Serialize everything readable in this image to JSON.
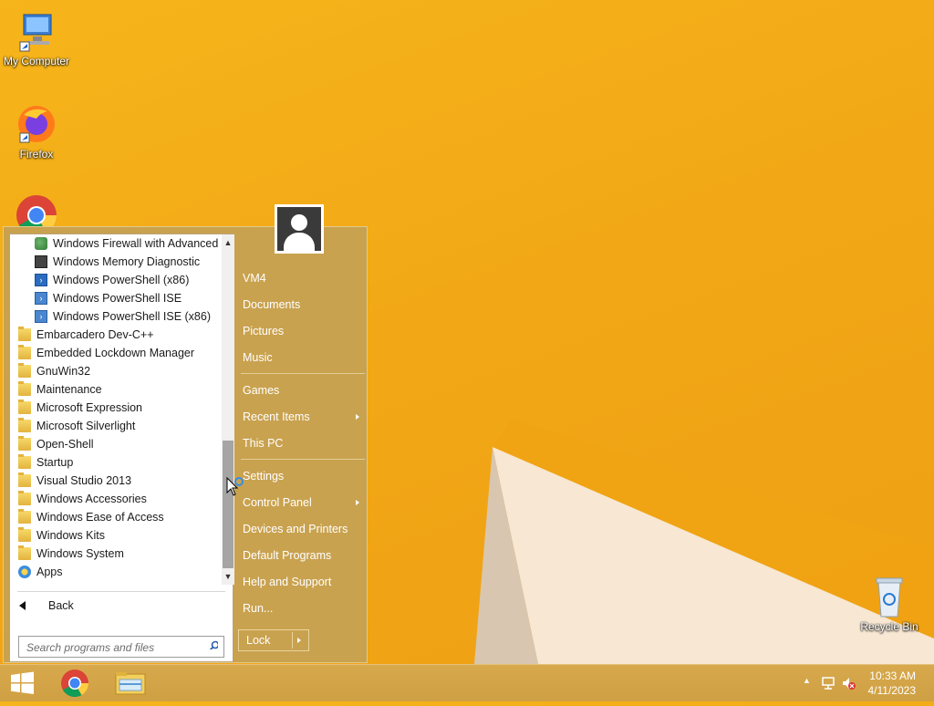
{
  "desktop": {
    "icons": [
      {
        "label": "My Computer",
        "icon": "computer-icon"
      },
      {
        "label": "Firefox",
        "icon": "firefox-icon"
      },
      {
        "label": "",
        "icon": "chrome-icon"
      },
      {
        "label": "Recycle Bin",
        "icon": "recycle-bin-icon"
      }
    ]
  },
  "start_menu": {
    "programs": [
      {
        "label": "Windows Firewall with Advanced",
        "icon": "firewall-icon",
        "level": "sub"
      },
      {
        "label": "Windows Memory Diagnostic",
        "icon": "memory-diagnostic-icon",
        "level": "sub"
      },
      {
        "label": "Windows PowerShell (x86)",
        "icon": "powershell-icon",
        "level": "sub"
      },
      {
        "label": "Windows PowerShell ISE",
        "icon": "powershell-ise-icon",
        "level": "sub"
      },
      {
        "label": "Windows PowerShell ISE (x86)",
        "icon": "powershell-ise-icon",
        "level": "sub"
      },
      {
        "label": "Embarcadero Dev-C++",
        "icon": "folder-icon",
        "level": "top"
      },
      {
        "label": "Embedded Lockdown Manager",
        "icon": "folder-icon",
        "level": "top"
      },
      {
        "label": "GnuWin32",
        "icon": "folder-icon",
        "level": "top"
      },
      {
        "label": "Maintenance",
        "icon": "folder-icon",
        "level": "top"
      },
      {
        "label": "Microsoft Expression",
        "icon": "folder-icon",
        "level": "top"
      },
      {
        "label": "Microsoft Silverlight",
        "icon": "folder-icon",
        "level": "top"
      },
      {
        "label": "Open-Shell",
        "icon": "folder-icon",
        "level": "top"
      },
      {
        "label": "Startup",
        "icon": "folder-icon",
        "level": "top"
      },
      {
        "label": "Visual Studio 2013",
        "icon": "folder-icon",
        "level": "top"
      },
      {
        "label": "Windows Accessories",
        "icon": "folder-icon",
        "level": "top"
      },
      {
        "label": "Windows Ease of Access",
        "icon": "folder-icon",
        "level": "top"
      },
      {
        "label": "Windows Kits",
        "icon": "folder-icon",
        "level": "top"
      },
      {
        "label": "Windows System",
        "icon": "folder-icon",
        "level": "top"
      },
      {
        "label": "Apps",
        "icon": "apps-icon",
        "level": "top"
      }
    ],
    "back_label": "Back",
    "search_placeholder": "Search programs and files",
    "right_items": [
      {
        "label": "VM4",
        "has_submenu": false
      },
      {
        "label": "Documents",
        "has_submenu": false
      },
      {
        "label": "Pictures",
        "has_submenu": false
      },
      {
        "label": "Music",
        "has_submenu": false
      },
      {
        "label": "Games",
        "has_submenu": false
      },
      {
        "label": "Recent Items",
        "has_submenu": true
      },
      {
        "label": "This PC",
        "has_submenu": false
      },
      {
        "label": "Settings",
        "has_submenu": false
      },
      {
        "label": "Control Panel",
        "has_submenu": true
      },
      {
        "label": "Devices and Printers",
        "has_submenu": false
      },
      {
        "label": "Default Programs",
        "has_submenu": false
      },
      {
        "label": "Help and Support",
        "has_submenu": false
      },
      {
        "label": "Run...",
        "has_submenu": false
      }
    ],
    "lock_label": "Lock"
  },
  "taskbar": {
    "pinned": [
      "start-icon",
      "chrome-icon",
      "file-explorer-icon"
    ],
    "clock_time": "10:33 AM",
    "clock_date": "4/11/2023"
  },
  "colors": {
    "wallpaper": "#f2a816",
    "menu_bg": "#c9a24f",
    "taskbar": "#d4a548"
  }
}
